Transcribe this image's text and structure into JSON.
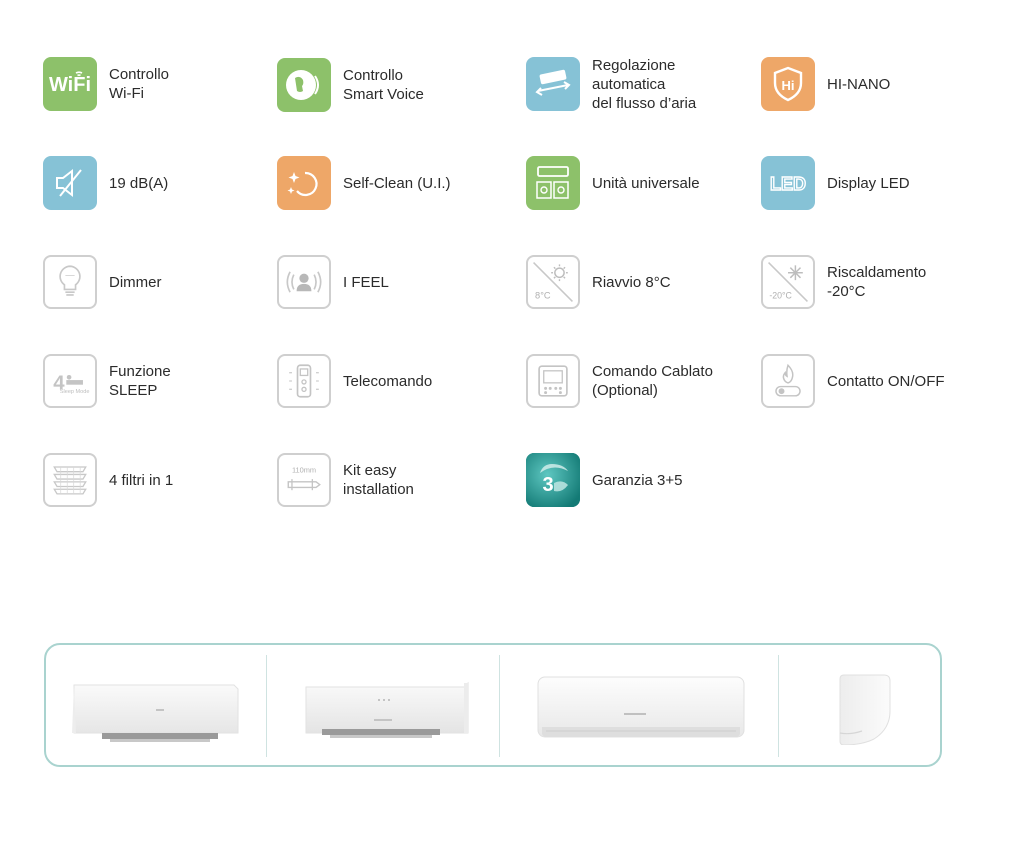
{
  "features": [
    {
      "label_lines": [
        "Controllo",
        "Wi-Fi"
      ],
      "icon": "wifi-icon",
      "style": "green"
    },
    {
      "label_lines": [
        "Controllo",
        "Smart Voice"
      ],
      "icon": "smart-voice-icon",
      "style": "green"
    },
    {
      "label_lines": [
        "Regolazione",
        "automatica",
        "del flusso d’aria"
      ],
      "icon": "airflow-icon",
      "style": "blue"
    },
    {
      "label_lines": [
        "HI-NANO"
      ],
      "icon": "hi-nano-shield-icon",
      "style": "orange"
    },
    {
      "label_lines": [
        "19 dB(A)"
      ],
      "icon": "mute-speaker-icon",
      "style": "blue"
    },
    {
      "label_lines": [
        "Self-Clean (U.I.)"
      ],
      "icon": "self-clean-sparkle-icon",
      "style": "orange"
    },
    {
      "label_lines": [
        "Unità universale"
      ],
      "icon": "universal-unit-icon",
      "style": "green"
    },
    {
      "label_lines": [
        "Display LED"
      ],
      "icon": "led-display-icon",
      "style": "blue"
    },
    {
      "label_lines": [
        "Dimmer"
      ],
      "icon": "dimmer-bulb-icon",
      "style": "outline"
    },
    {
      "label_lines": [
        "I FEEL"
      ],
      "icon": "i-feel-person-icon",
      "style": "outline"
    },
    {
      "label_lines": [
        "Riavvio 8°C"
      ],
      "icon": "restart-8c-sun-icon",
      "style": "outline",
      "icon_text": "8°C"
    },
    {
      "label_lines": [
        "Riscaldamento",
        "-20°C"
      ],
      "icon": "heating-snowflake-icon",
      "style": "outline",
      "icon_text": "-20°C"
    },
    {
      "label_lines": [
        "Funzione",
        "SLEEP"
      ],
      "icon": "sleep-mode-icon",
      "style": "outline",
      "icon_text": "4",
      "icon_subtext": "Sleep Mode"
    },
    {
      "label_lines": [
        "Telecomando"
      ],
      "icon": "remote-control-icon",
      "style": "outline"
    },
    {
      "label_lines": [
        "Comando Cablato",
        "(Optional)"
      ],
      "icon": "wired-controller-icon",
      "style": "outline"
    },
    {
      "label_lines": [
        "Contatto ON/OFF"
      ],
      "icon": "on-off-contact-flame-icon",
      "style": "outline"
    },
    {
      "label_lines": [
        "4 filtri in 1"
      ],
      "icon": "four-filters-icon",
      "style": "outline"
    },
    {
      "label_lines": [
        "Kit easy",
        "installation"
      ],
      "icon": "easy-install-kit-icon",
      "style": "outline",
      "icon_text": "110mm"
    },
    {
      "label_lines": [
        "Garanzia 3+5"
      ],
      "icon": "warranty-3-5-icon",
      "style": "teal",
      "icon_text": "3"
    }
  ],
  "colors": {
    "green": "#8dc16a",
    "orange": "#eea768",
    "blue": "#86c2d6",
    "teal": "#1f8f88",
    "outline_border": "#cfcfcf",
    "strip_border": "#a9d3cf"
  },
  "product_strip": {
    "units": [
      "indoor-unit-left-angle",
      "indoor-unit-right-angle",
      "indoor-unit-front",
      "indoor-unit-side"
    ]
  }
}
